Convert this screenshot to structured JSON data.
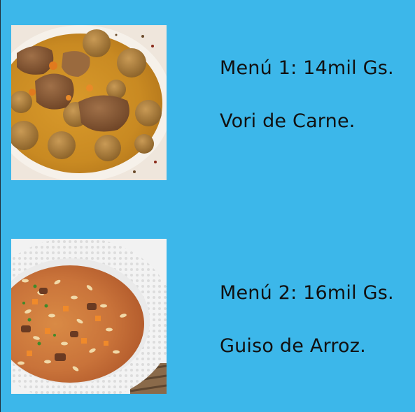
{
  "colors": {
    "background": "#3cb7ea",
    "text": "#111111"
  },
  "menus": [
    {
      "price_label": "Menú 1: 14mil Gs.",
      "dish_name": "Vori de Carne.",
      "photo": "vori-vori-stew-photo"
    },
    {
      "price_label": "Menú 2: 16mil Gs.",
      "dish_name": "Guiso de Arroz.",
      "photo": "rice-stew-photo"
    }
  ]
}
